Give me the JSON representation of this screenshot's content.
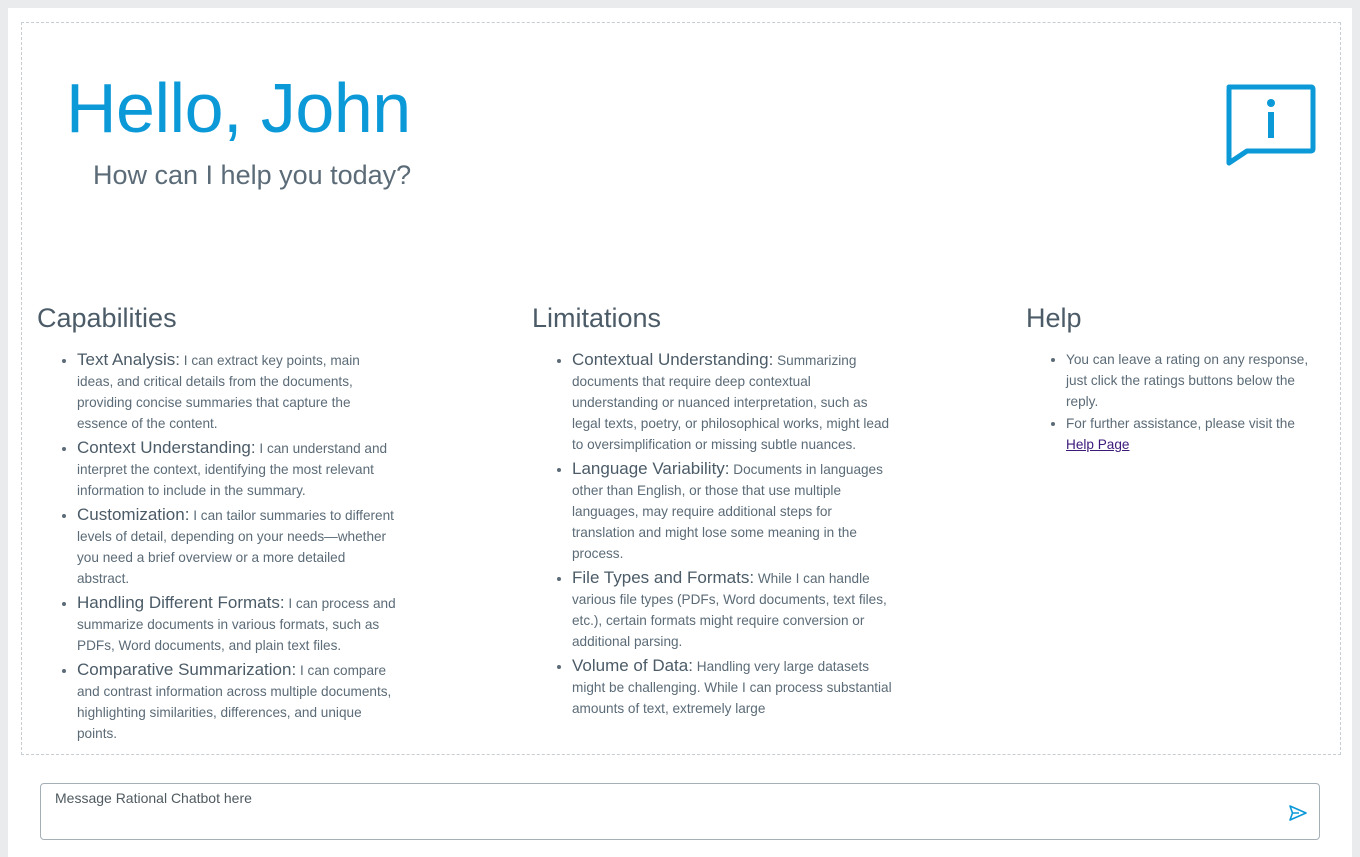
{
  "header": {
    "greeting": "Hello, John",
    "subgreeting": "How can I help you today?",
    "info_icon": "speech-bubble-info-icon",
    "accent_color": "#0b99d8"
  },
  "capabilities": {
    "title": "Capabilities",
    "items": [
      {
        "term": "Text Analysis:",
        "text": " I can extract key points, main ideas, and critical details from the documents, providing concise summaries that capture the essence of the content."
      },
      {
        "term": "Context Understanding:",
        "text": " I can understand and interpret the context, identifying the most relevant information to include in the summary."
      },
      {
        "term": "Customization:",
        "text": " I can tailor summaries to different levels of detail, depending on your needs—whether you need a brief overview or a more detailed abstract."
      },
      {
        "term": "Handling Different Formats:",
        "text": " I can process and summarize documents in various formats, such as PDFs, Word documents, and plain text files."
      },
      {
        "term": "Comparative Summarization:",
        "text": " I can compare and contrast information across multiple documents, highlighting similarities, differences, and unique points."
      }
    ]
  },
  "limitations": {
    "title": "Limitations",
    "items": [
      {
        "term": "Contextual Understanding:",
        "text": " Summarizing documents that require deep contextual understanding or nuanced interpretation, such as legal texts, poetry, or philosophical works, might lead to oversimplification or missing subtle nuances."
      },
      {
        "term": "Language Variability:",
        "text": " Documents in languages other than English, or those that use multiple languages, may require additional steps for translation and might lose some meaning in the process."
      },
      {
        "term": "File Types and Formats:",
        "text": " While I can handle various file types (PDFs, Word documents, text files, etc.), certain formats might require conversion or additional parsing."
      },
      {
        "term": "Volume of Data:",
        "text": " Handling very large datasets might be challenging. While I can process substantial amounts of text, extremely large"
      }
    ]
  },
  "help": {
    "title": "Help",
    "items": [
      {
        "text": "You can leave a rating on any response, just click the ratings buttons below the reply."
      },
      {
        "text": "For further assistance, please visit the ",
        "link": "Help Page"
      }
    ]
  },
  "composer": {
    "placeholder": "Message Rational Chatbot here",
    "value": "",
    "send_icon": "send-icon"
  }
}
